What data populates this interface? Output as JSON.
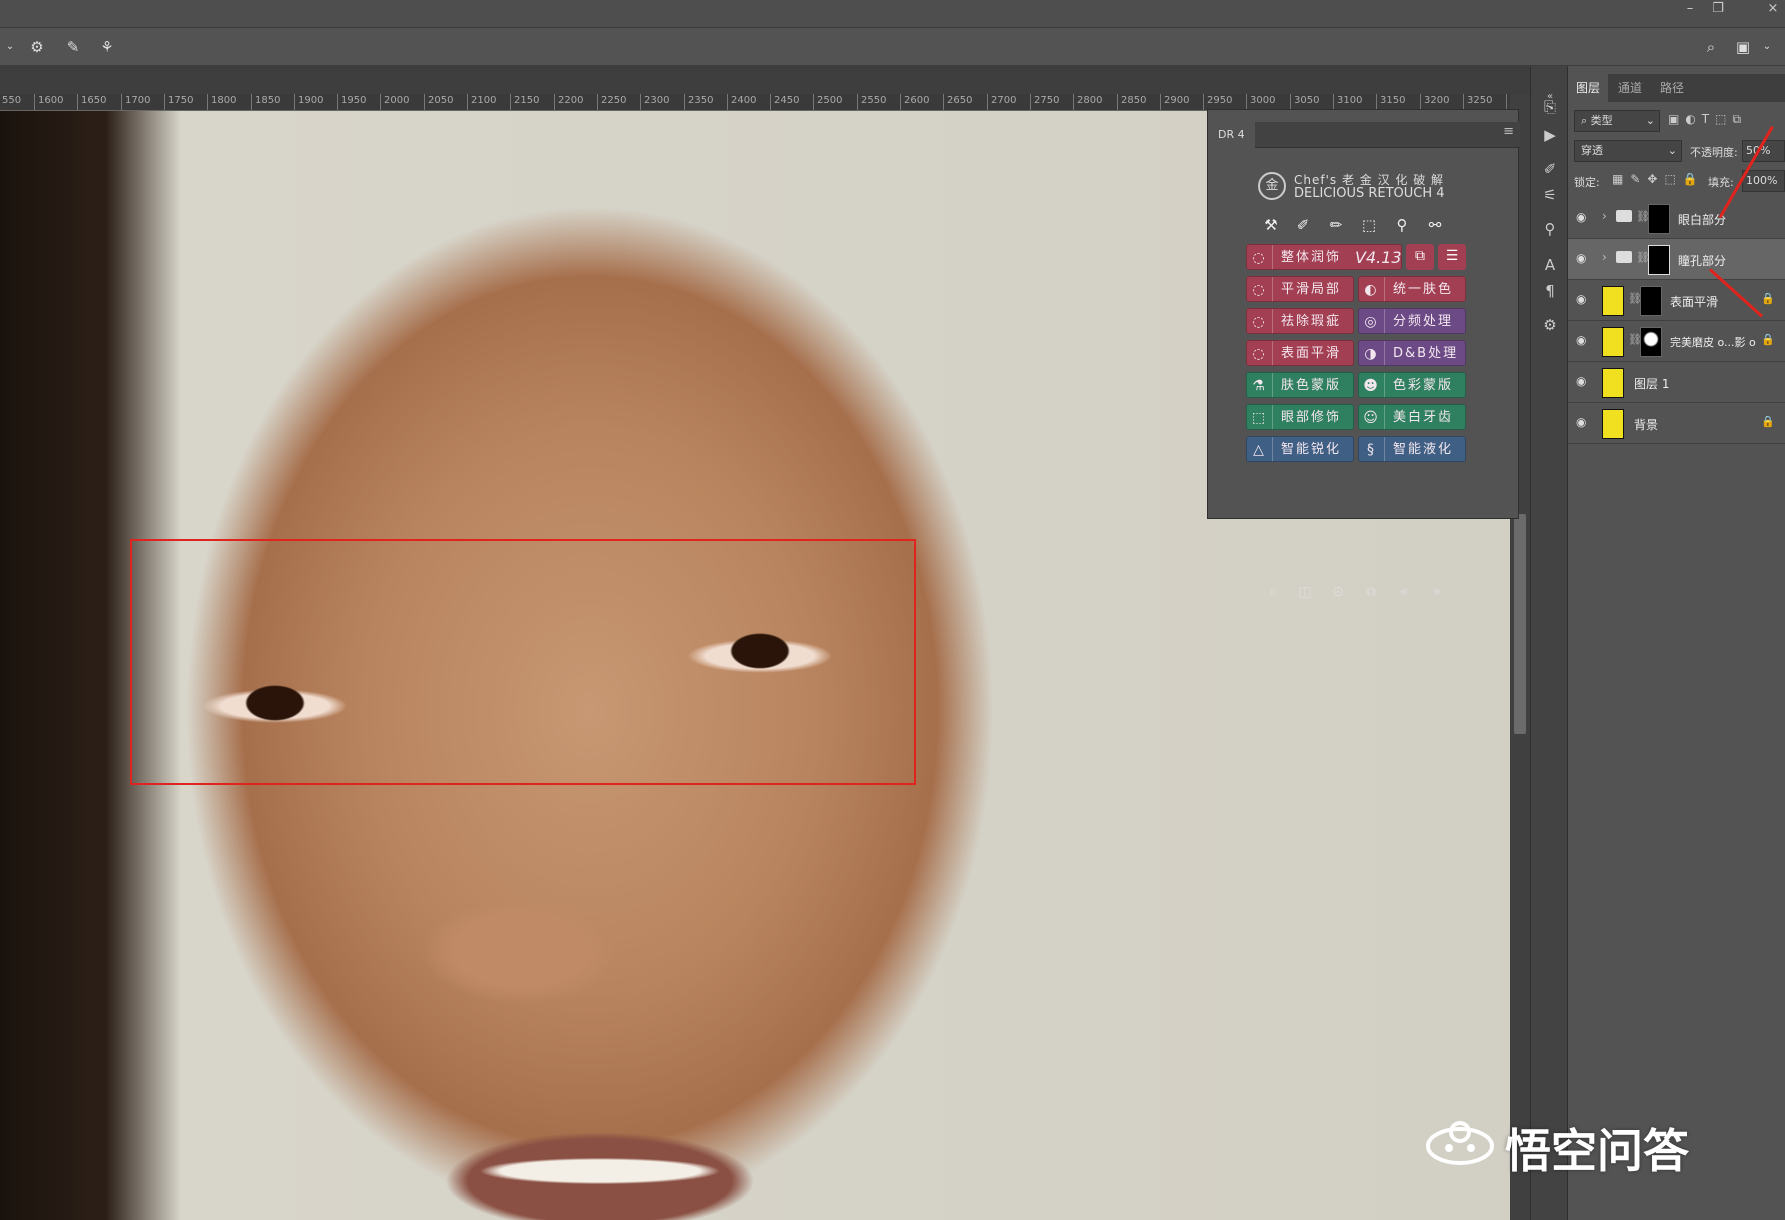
{
  "ruler": {
    "ticks": [
      "550",
      "1600",
      "1650",
      "1700",
      "1750",
      "1800",
      "1850",
      "1900",
      "1950",
      "2000",
      "2050",
      "2100",
      "2150",
      "2200",
      "2250",
      "2300",
      "2350",
      "2400",
      "2450",
      "2500",
      "2550",
      "2600",
      "2650",
      "2700",
      "2750",
      "2800",
      "2850",
      "2900",
      "2950",
      "3000",
      "3050",
      "3100",
      "3150",
      "3200",
      "3250",
      "3"
    ]
  },
  "window_controls": {
    "minimize": "–",
    "restore": "❐",
    "close": "×"
  },
  "dr4": {
    "tab": "DR 4",
    "logo_line1": "Chef's 老 金 汉 化 破 解",
    "logo_line2": "DELICIOUS RETOUCH 4",
    "logo_mark": "金",
    "version": "V4.13",
    "buttons": [
      {
        "label": "整体润饰",
        "color": "red"
      },
      {
        "label": "平滑局部",
        "color": "red"
      },
      {
        "label": "统一肤色",
        "color": "red"
      },
      {
        "label": "祛除瑕疵",
        "color": "red"
      },
      {
        "label": "分频处理",
        "color": "purple"
      },
      {
        "label": "表面平滑",
        "color": "red"
      },
      {
        "label": "D&B处理",
        "color": "purple"
      },
      {
        "label": "肤色蒙版",
        "color": "green"
      },
      {
        "label": "色彩蒙版",
        "color": "green"
      },
      {
        "label": "眼部修饰",
        "color": "green"
      },
      {
        "label": "美白牙齿",
        "color": "green"
      },
      {
        "label": "智能锐化",
        "color": "blue"
      },
      {
        "label": "智能液化",
        "color": "blue"
      }
    ],
    "footer": {
      "prev": "«",
      "next": "»"
    }
  },
  "layers_panel": {
    "tabs": [
      "图层",
      "通道",
      "路径"
    ],
    "filter": "类型",
    "blend_mode": "穿透",
    "opacity_label": "不透明度:",
    "opacity_value": "50%",
    "lock_label": "锁定:",
    "fill_label": "填充:",
    "fill_value": "100%",
    "layers": [
      {
        "name": "眼白部分",
        "type": "group"
      },
      {
        "name": "瞳孔部分",
        "type": "group"
      },
      {
        "name": "表面平滑",
        "type": "layer"
      },
      {
        "name": "完美磨皮 o...影 o",
        "type": "layer"
      },
      {
        "name": "图层 1",
        "type": "layer"
      },
      {
        "name": "背景",
        "type": "layer"
      }
    ]
  },
  "watermark": {
    "text": "悟空问答"
  },
  "colors": {
    "annotation": "#e0241d",
    "panel": "#535353",
    "dr_red": "#a33f53",
    "dr_purple": "#6b4a86",
    "dr_green": "#2f8060",
    "dr_blue": "#3f5f84"
  }
}
